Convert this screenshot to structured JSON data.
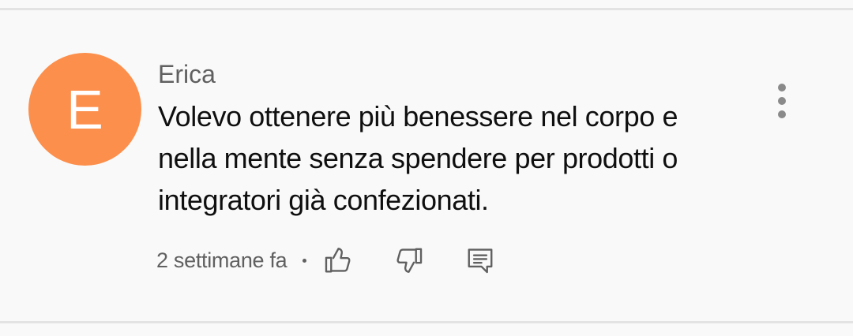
{
  "comment": {
    "author": "Erica",
    "avatar_letter": "E",
    "avatar_color": "#fc8f4c",
    "text": "Volevo ottenere più benessere nel corpo e nella mente senza spendere per prodotti o integratori già confezionati.",
    "timestamp": "2 settimane fa",
    "menu_icon": "more-vertical-icon",
    "actions": {
      "like_icon": "thumb-up-icon",
      "dislike_icon": "thumb-down-icon",
      "reply_icon": "comment-reply-icon"
    }
  }
}
